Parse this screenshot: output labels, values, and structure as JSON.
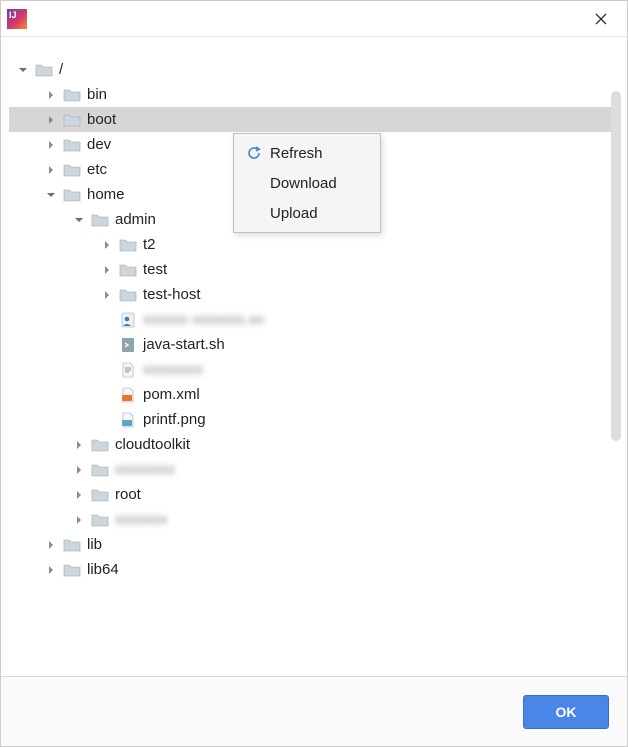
{
  "footer": {
    "ok_label": "OK"
  },
  "context_menu": {
    "items": [
      {
        "label": "Refresh",
        "icon": "refresh-icon"
      },
      {
        "label": "Download",
        "icon": ""
      },
      {
        "label": "Upload",
        "icon": ""
      }
    ]
  },
  "tree": {
    "rows": [
      {
        "depth": 0,
        "expand": "open",
        "kind": "folder",
        "label": "/",
        "selected": false,
        "blur": false
      },
      {
        "depth": 1,
        "expand": "closed",
        "kind": "folder",
        "label": "bin",
        "selected": false,
        "blur": false
      },
      {
        "depth": 1,
        "expand": "closed",
        "kind": "folder",
        "label": "boot",
        "selected": true,
        "blur": false
      },
      {
        "depth": 1,
        "expand": "closed",
        "kind": "folder",
        "label": "dev",
        "selected": false,
        "blur": false
      },
      {
        "depth": 1,
        "expand": "closed",
        "kind": "folder",
        "label": "etc",
        "selected": false,
        "blur": false
      },
      {
        "depth": 1,
        "expand": "open",
        "kind": "folder",
        "label": "home",
        "selected": false,
        "blur": false
      },
      {
        "depth": 2,
        "expand": "open",
        "kind": "folder",
        "label": "admin",
        "selected": false,
        "blur": false
      },
      {
        "depth": 3,
        "expand": "closed",
        "kind": "folder",
        "label": "t2",
        "selected": false,
        "blur": false
      },
      {
        "depth": 3,
        "expand": "closed",
        "kind": "folder",
        "label": "test",
        "selected": false,
        "blur": false
      },
      {
        "depth": 3,
        "expand": "closed",
        "kind": "folder",
        "label": "test-host",
        "selected": false,
        "blur": false
      },
      {
        "depth": 3,
        "expand": "none",
        "kind": "file-user",
        "label": "xxxxxx xxxxxxx.xx",
        "selected": false,
        "blur": true
      },
      {
        "depth": 3,
        "expand": "none",
        "kind": "file-sh",
        "label": "java-start.sh",
        "selected": false,
        "blur": false
      },
      {
        "depth": 3,
        "expand": "none",
        "kind": "file-txt",
        "label": "xxxxxxxx",
        "selected": false,
        "blur": true
      },
      {
        "depth": 3,
        "expand": "none",
        "kind": "file-xml",
        "label": "pom.xml",
        "selected": false,
        "blur": false
      },
      {
        "depth": 3,
        "expand": "none",
        "kind": "file-img",
        "label": "printf.png",
        "selected": false,
        "blur": false
      },
      {
        "depth": 2,
        "expand": "closed",
        "kind": "folder",
        "label": "cloudtoolkit",
        "selected": false,
        "blur": false
      },
      {
        "depth": 2,
        "expand": "closed",
        "kind": "folder",
        "label": "xxxxxxxx",
        "selected": false,
        "blur": true
      },
      {
        "depth": 2,
        "expand": "closed",
        "kind": "folder",
        "label": "root",
        "selected": false,
        "blur": false
      },
      {
        "depth": 2,
        "expand": "closed",
        "kind": "folder",
        "label": "xxxxxxx",
        "selected": false,
        "blur": true
      },
      {
        "depth": 1,
        "expand": "closed",
        "kind": "folder",
        "label": "lib",
        "selected": false,
        "blur": false
      },
      {
        "depth": 1,
        "expand": "closed",
        "kind": "folder",
        "label": "lib64",
        "selected": false,
        "blur": false
      }
    ]
  }
}
